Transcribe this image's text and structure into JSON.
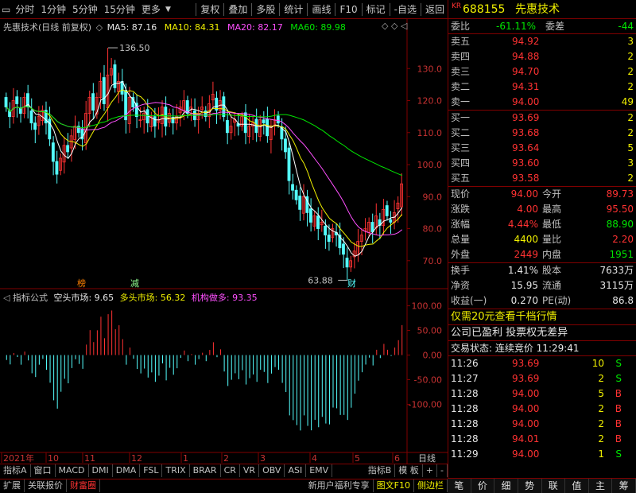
{
  "toolbar": {
    "main": [
      "分时",
      "1分钟",
      "5分钟",
      "15分钟",
      "更多"
    ],
    "right": [
      "复权",
      "叠加",
      "多股",
      "统计",
      "画线",
      "F10",
      "标记",
      "-自选",
      "返回"
    ]
  },
  "legend_main": {
    "name": "先惠技术(日线 前复权)",
    "ma5": "MA5: 87.16",
    "ma10": "MA10: 84.31",
    "ma20": "MA20: 82.17",
    "ma60": "MA60: 89.98"
  },
  "legend_sub": {
    "name": "指标公式",
    "v1": "空头市场: 9.65",
    "v2": "多头市场: 56.32",
    "v3": "机构做多: 93.35"
  },
  "annotations": {
    "high": "136.50",
    "low": "63.88",
    "tag1": "榜",
    "tag2": "减",
    "tag3": "财"
  },
  "xaxis": {
    "labels": [
      "2021年",
      "10",
      "11",
      "12",
      "1",
      "2",
      "3",
      "4",
      "5",
      "6"
    ],
    "right": "日线"
  },
  "bottom_tabs1": [
    "指标A",
    "窗口",
    "MACD",
    "DMI",
    "DMA",
    "FSL",
    "TRIX",
    "BRAR",
    "CR",
    "VR",
    "OBV",
    "ASI",
    "EMV"
  ],
  "bottom_tabs1_right": [
    "指标B",
    "模 板",
    "+",
    "-"
  ],
  "bottom_tabs2": [
    "扩展",
    "关联报价",
    "财富圈"
  ],
  "bottom_tabs2_right": [
    "新用户福利专享",
    "图文F10",
    "侧边栏"
  ],
  "side": {
    "code": "688155",
    "name": "先惠技术",
    "tag": "KR",
    "weibi": {
      "label": "委比",
      "value": "-61.11%",
      "label2": "委差",
      "value2": "-44"
    },
    "asks": [
      {
        "label": "卖五",
        "price": "94.92",
        "vol": "3"
      },
      {
        "label": "卖四",
        "price": "94.88",
        "vol": "2"
      },
      {
        "label": "卖三",
        "price": "94.70",
        "vol": "2"
      },
      {
        "label": "卖二",
        "price": "94.31",
        "vol": "2"
      },
      {
        "label": "卖一",
        "price": "94.00",
        "vol": "49"
      }
    ],
    "bids": [
      {
        "label": "买一",
        "price": "93.69",
        "vol": "2"
      },
      {
        "label": "买二",
        "price": "93.68",
        "vol": "2"
      },
      {
        "label": "买三",
        "price": "93.64",
        "vol": "5"
      },
      {
        "label": "买四",
        "price": "93.60",
        "vol": "3"
      },
      {
        "label": "买五",
        "price": "93.58",
        "vol": "2"
      }
    ],
    "stats": [
      {
        "l1": "现价",
        "v1": "94.00",
        "c1": "red",
        "l2": "今开",
        "v2": "89.73",
        "c2": "red"
      },
      {
        "l1": "涨跌",
        "v1": "4.00",
        "c1": "red",
        "l2": "最高",
        "v2": "95.50",
        "c2": "red"
      },
      {
        "l1": "涨幅",
        "v1": "4.44%",
        "c1": "red",
        "l2": "最低",
        "v2": "88.90",
        "c2": "grn"
      },
      {
        "l1": "总量",
        "v1": "4400",
        "c1": "yel",
        "l2": "量比",
        "v2": "2.20",
        "c2": "red"
      },
      {
        "l1": "外盘",
        "v1": "2449",
        "c1": "red",
        "l2": "内盘",
        "v2": "1951",
        "c2": "grn"
      }
    ],
    "stats2": [
      {
        "l1": "换手",
        "v1": "1.41%",
        "l2": "股本",
        "v2": "7633万"
      },
      {
        "l1": "净资",
        "v1": "15.95",
        "l2": "流通",
        "v2": "3115万"
      },
      {
        "l1": "收益(一)",
        "v1": "0.270",
        "l2": "PE(动)",
        "v2": "86.8"
      }
    ],
    "promo": "仅需20元查看千档行情",
    "info": "公司已盈利 投票权无差异",
    "status": "交易状态: 连续竞价 11:29:41",
    "ticks": [
      {
        "t": "11:26",
        "p": "93.69",
        "pc": "red",
        "v": "10",
        "s": "S",
        "sc": "grn",
        "vc": "yel"
      },
      {
        "t": "11:27",
        "p": "93.69",
        "pc": "red",
        "v": "2",
        "s": "S",
        "sc": "grn",
        "vc": "yel"
      },
      {
        "t": "11:28",
        "p": "94.00",
        "pc": "red",
        "v": "5",
        "s": "B",
        "sc": "red",
        "vc": "yel"
      },
      {
        "t": "11:28",
        "p": "94.00",
        "pc": "red",
        "v": "2",
        "s": "B",
        "sc": "red",
        "vc": "yel"
      },
      {
        "t": "11:28",
        "p": "94.00",
        "pc": "red",
        "v": "2",
        "s": "B",
        "sc": "red",
        "vc": "yel"
      },
      {
        "t": "11:28",
        "p": "94.01",
        "pc": "red",
        "v": "2",
        "s": "B",
        "sc": "red",
        "vc": "yel"
      },
      {
        "t": "11:29",
        "p": "94.00",
        "pc": "red",
        "v": "1",
        "s": "S",
        "sc": "grn",
        "vc": "yel"
      }
    ],
    "bottom": [
      "笔",
      "价",
      "细",
      "势",
      "联",
      "值",
      "主",
      "筹"
    ]
  },
  "chart_data": [
    {
      "type": "candlestick",
      "yticks": [
        70,
        80,
        90,
        100,
        110,
        120,
        130
      ],
      "ylim": [
        62,
        140
      ],
      "high_label": 136.5,
      "low_label": 63.88,
      "close": [
        118,
        115,
        120,
        119,
        116,
        121,
        118,
        113,
        111,
        115,
        117,
        113,
        108,
        101,
        97,
        102,
        106,
        104,
        109,
        112,
        110,
        108,
        116,
        121,
        117,
        121,
        126,
        119,
        128,
        130,
        124,
        126,
        122,
        114,
        121,
        118,
        115,
        114,
        116,
        113,
        115,
        112,
        114,
        118,
        112,
        116,
        113,
        115,
        118,
        120,
        116,
        118,
        114,
        116,
        118,
        115,
        119,
        122,
        117,
        120,
        115,
        110,
        112,
        114,
        112,
        115,
        110,
        112,
        113,
        110,
        114,
        113,
        109,
        112,
        114,
        113,
        108,
        104,
        95,
        92,
        89,
        86,
        90,
        85,
        82,
        84,
        80,
        82,
        78,
        76,
        80,
        78,
        74,
        72,
        68,
        70,
        73,
        76,
        78,
        80,
        82,
        79,
        84,
        81,
        86,
        84,
        82,
        85,
        88,
        94
      ]
    },
    {
      "type": "bar",
      "series_names": [
        "空头市场",
        "多头市场",
        "机构做多"
      ],
      "yticks": [
        100,
        50,
        0,
        -50,
        -100
      ],
      "ylim": [
        -180,
        130
      ]
    }
  ]
}
